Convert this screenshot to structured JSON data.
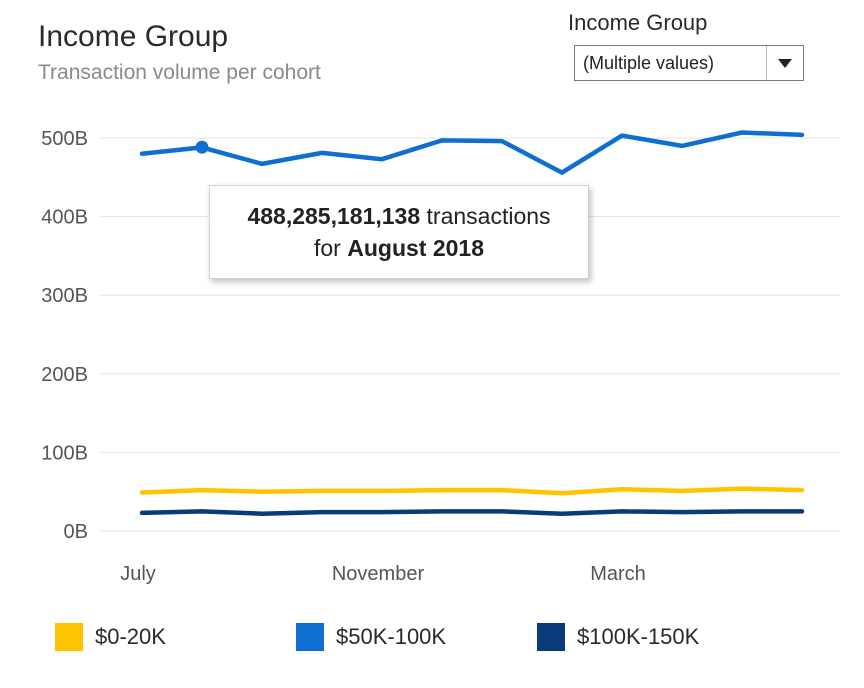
{
  "header": {
    "title": "Income Group",
    "subtitle": "Transaction volume per cohort"
  },
  "filter": {
    "label": "Income Group",
    "value": "(Multiple values)",
    "icon": "dropdown-triangle-icon"
  },
  "tooltip": {
    "value": "488,285,181,138",
    "mid": " transactions",
    "prefix": "for ",
    "period": "August 2018"
  },
  "chart_data": {
    "type": "line",
    "title": "Income Group",
    "subtitle": "Transaction volume per cohort",
    "x_tick_labels": [
      "July",
      "November",
      "March"
    ],
    "y_tick_labels": [
      "0B",
      "100B",
      "200B",
      "300B",
      "400B",
      "500B"
    ],
    "y_ticks": [
      0,
      100,
      200,
      300,
      400,
      500
    ],
    "ylim": [
      0,
      500
    ],
    "grid": true,
    "legend_position": "bottom",
    "x": [
      "2018-07",
      "2018-08",
      "2018-09",
      "2018-10",
      "2018-11",
      "2018-12",
      "2019-01",
      "2019-02",
      "2019-03",
      "2019-04",
      "2019-05",
      "2019-06"
    ],
    "highlighted_point": {
      "series": "$50K-100K",
      "x": "2018-08",
      "y": 488.285181138
    },
    "series": [
      {
        "name": "$0-20K",
        "color": "#ffc400",
        "values": [
          49,
          52,
          50,
          51,
          51,
          52,
          52,
          48,
          53,
          51,
          54,
          52
        ]
      },
      {
        "name": "$50K-100K",
        "color": "#0f6fd0",
        "values": [
          480,
          488,
          467,
          481,
          473,
          497,
          496,
          456,
          503,
          490,
          507,
          504
        ]
      },
      {
        "name": "$100K-150K",
        "color": "#0a3a7a",
        "values": [
          23,
          25,
          22,
          24,
          24,
          25,
          25,
          22,
          25,
          24,
          25,
          25
        ]
      }
    ]
  }
}
